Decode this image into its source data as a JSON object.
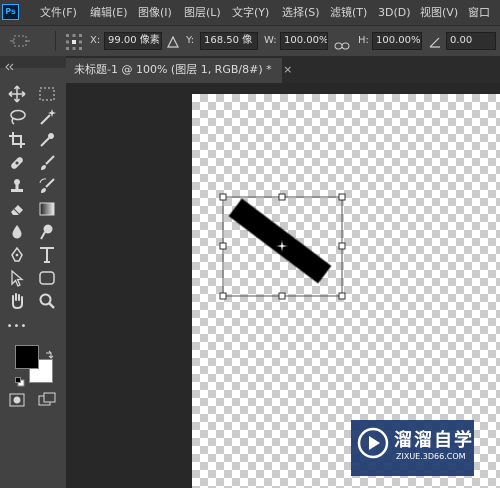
{
  "app": {
    "logo": "Ps"
  },
  "menu": [
    "文件(F)",
    "编辑(E)",
    "图像(I)",
    "图层(L)",
    "文字(Y)",
    "选择(S)",
    "滤镜(T)",
    "3D(D)",
    "视图(V)",
    "窗口"
  ],
  "options": {
    "x_label": "X:",
    "x_value": "99.00 像素",
    "y_label": "Y:",
    "y_value": "168.50 像",
    "w_label": "W:",
    "w_value": "100.00%",
    "h_label": "H:",
    "h_value": "100.00%",
    "angle_value": "0.00"
  },
  "document": {
    "tab_title": "未标题-1 @ 100% (图层 1, RGB/8#) *",
    "close": "×"
  },
  "toolbar": {
    "collapse_icon": "double-chevron",
    "more_tools": "•••"
  },
  "colors": {
    "foreground": "#000000",
    "background": "#ffffff",
    "accent": "#31a8ff"
  },
  "watermark": {
    "brand": "溜溜自学",
    "url": "ZIXUE.3D66.COM"
  }
}
